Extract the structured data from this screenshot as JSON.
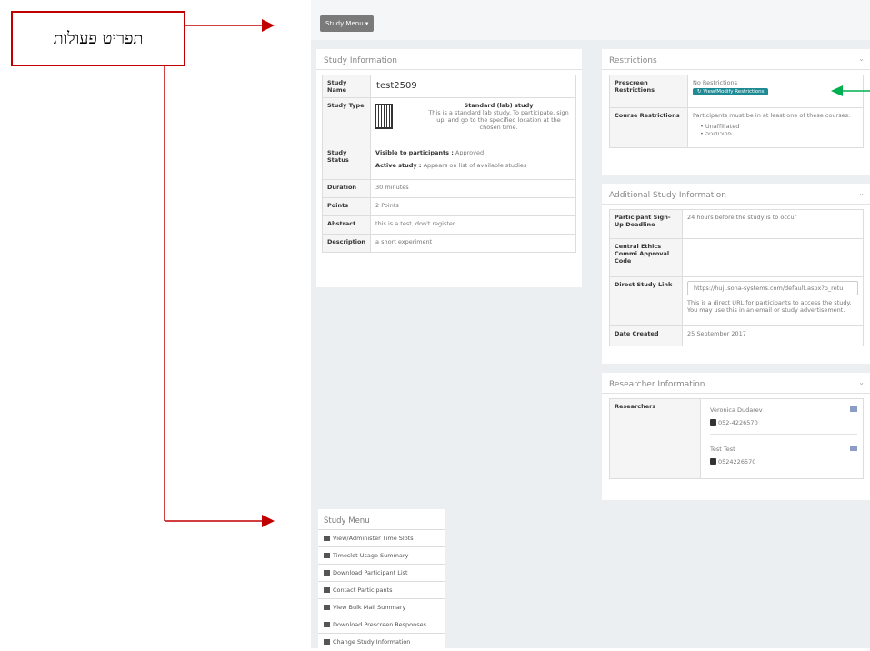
{
  "annotation": {
    "callout_text": "תפריט פעולות"
  },
  "topbar": {
    "study_menu_label": "Study Menu ▾"
  },
  "study_info": {
    "title": "Study Information",
    "name_key": "Study Name",
    "name_val": "test2509",
    "type_key": "Study Type",
    "type_title": "Standard (lab) study",
    "type_desc": "This is a standard lab study. To participate, sign up, and go to the specified location at the chosen time.",
    "status_key": "Study Status",
    "visible_key": "Visible to participants :",
    "visible_val": "Approved",
    "active_key": "Active study :",
    "active_val": "Appears on list of available studies",
    "duration_key": "Duration",
    "duration_val": "30 minutes",
    "points_key": "Points",
    "points_val": "2 Points",
    "abstract_key": "Abstract",
    "abstract_val": "this is a test, don't register",
    "description_key": "Description",
    "description_val": "a short experiment"
  },
  "restrictions": {
    "title": "Restrictions",
    "prescreen_key": "Prescreen Restrictions",
    "prescreen_val": "No Restrictions",
    "modify_button": "View/Modify Restrictions",
    "course_key": "Course Restrictions",
    "course_val": "Participants must be in at least one of these courses:",
    "course_1": "Unaffiliated",
    "course_2": "פסיכולוגיה"
  },
  "additional": {
    "title": "Additional Study Information",
    "deadline_key": "Participant Sign-Up Deadline",
    "deadline_val": "24 hours before the study is to occur",
    "ethics_key": "Central Ethics Commi Approval Code",
    "link_key": "Direct Study Link",
    "link_url": "https://huji.sona-systems.com/default.aspx?p_retu",
    "link_note": "This is a direct URL for participants to access the study. You may use this in an email or study advertisement.",
    "created_key": "Date Created",
    "created_val": "25 September 2017"
  },
  "researchers": {
    "title": "Researcher Information",
    "key": "Researchers",
    "list": [
      {
        "name": "Veronica Dudarev",
        "phone": "052-4226570"
      },
      {
        "name": "Test Test",
        "phone": "0524226570"
      }
    ]
  },
  "menu": {
    "title": "Study Menu",
    "items": [
      "View/Administer Time Slots",
      "Timeslot Usage Summary",
      "Download Participant List",
      "Contact Participants",
      "View Bulk Mail Summary",
      "Download Prescreen Responses",
      "Change Study Information"
    ]
  },
  "colors": {
    "annotation_red": "#c00000",
    "annotation_green": "#00b050",
    "teal_button": "#1d8a94"
  }
}
